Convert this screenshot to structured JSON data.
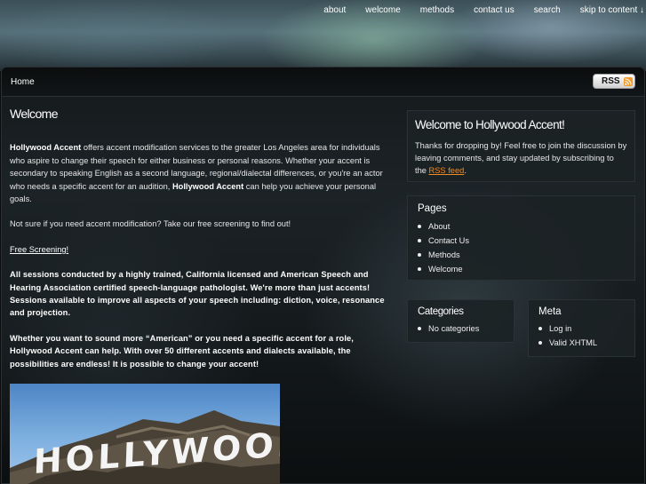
{
  "topnav": {
    "items": [
      "about",
      "welcome",
      "methods",
      "contact us",
      "search",
      "skip to content ↓"
    ]
  },
  "menubar": {
    "home": "Home",
    "ghost_text": "No categories",
    "rss_label": "RSS"
  },
  "main": {
    "title": "Welcome",
    "p1_brand": "Hollywood Accent",
    "p1_text_a": " offers accent modification services to the greater Los Angeles area for individuals who aspire to change their speech for either business or personal reasons.  Whether your accent is secondary to speaking English as a second language, regional/dialectal differences, or you're an actor who needs a specific accent for an audition, ",
    "p1_brand2": "Hollywood Accent",
    "p1_text_b": " can help you achieve your personal goals.",
    "p2": "Not sure if you need accent modification?  Take our free screening to find out!",
    "p3_link": "Free Screening!",
    "p4": "All sessions conducted by a highly trained, California licensed and American Speech and Hearing Association certified speech-language pathologist. We're more than just accents! Sessions available to improve all aspects of your speech including: diction, voice, resonance and projection.",
    "p5": "Whether you want to sound more “American” or you need a specific accent for a role, Hollywood Accent can help. With over 50 different accents and dialects available, the possibilities are endless! It is possible to change your accent!",
    "photo_sign": "HOLLYWOOD"
  },
  "sidebar": {
    "welcome_title": "Welcome to Hollywood Accent!",
    "welcome_text": "Thanks for dropping by! Feel free to join the discussion by leaving comments, and stay updated by subscribing to the ",
    "welcome_link": "RSS feed",
    "welcome_end": ".",
    "pages_title": "Pages",
    "pages": [
      "About",
      "Contact Us",
      "Methods",
      "Welcome"
    ],
    "categories_title": "Categories",
    "categories": [
      "No categories"
    ],
    "meta_title": "Meta",
    "meta": [
      "Log in",
      "Valid XHTML"
    ]
  }
}
